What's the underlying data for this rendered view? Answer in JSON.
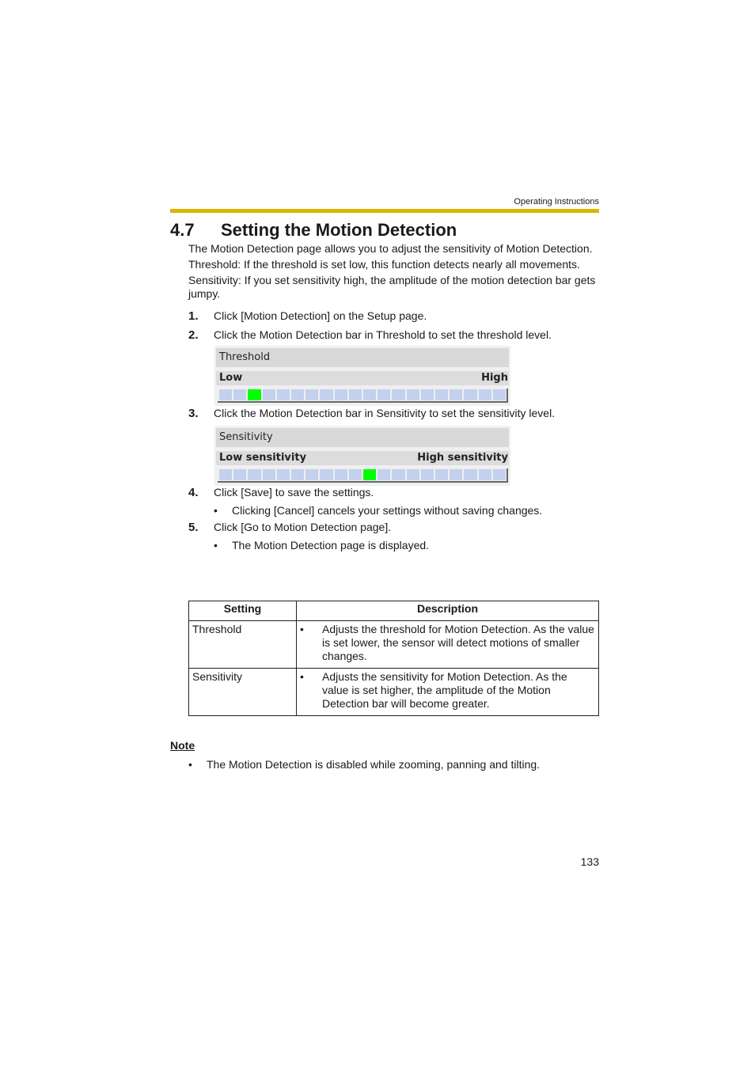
{
  "header": {
    "section_label": "Operating Instructions",
    "rule_color": "#d9b600"
  },
  "title": {
    "number": "4.7",
    "text": "Setting the Motion Detection"
  },
  "intro": [
    "The Motion Detection page allows you to adjust the sensitivity of Motion Detection.",
    "Threshold: If the threshold is set low, this function detects nearly all movements.",
    "Sensitivity: If you set sensitivity high, the amplitude of the motion detection bar gets jumpy."
  ],
  "steps": [
    {
      "num": "1.",
      "text": "Click [Motion Detection] on the Setup page."
    },
    {
      "num": "2.",
      "text": "Click the Motion Detection bar in Threshold to set the threshold level."
    },
    {
      "num": "3.",
      "text": "Click the Motion Detection bar in Sensitivity to set the sensitivity level."
    },
    {
      "num": "4.",
      "text": "Click [Save] to save the settings.",
      "bullet": "Clicking [Cancel] cancels your settings without saving changes."
    },
    {
      "num": "5.",
      "text": "Click [Go to Motion Detection page].",
      "bullet": "The Motion Detection page is displayed."
    }
  ],
  "threshold_panel": {
    "title": "Threshold",
    "low_label": "Low",
    "high_label": "High",
    "segments": 20,
    "selected_level": 3,
    "active_color": "#00ff00",
    "inactive_color": "#c4d0ee"
  },
  "sensitivity_panel": {
    "title": "Sensitivity",
    "low_label": "Low sensitivity",
    "high_label": "High sensitivity",
    "segments": 20,
    "selected_level": 11,
    "active_color": "#00ff00",
    "inactive_color": "#c4d0ee"
  },
  "table": {
    "headers": [
      "Setting",
      "Description"
    ],
    "rows": [
      {
        "setting": "Threshold",
        "description": "Adjusts the threshold for Motion Detection. As the value is set lower, the sensor will detect motions of smaller changes."
      },
      {
        "setting": "Sensitivity",
        "description": "Adjusts the sensitivity for Motion Detection. As the value is set higher, the amplitude of the Motion Detection bar will become greater."
      }
    ]
  },
  "note": {
    "title": "Note",
    "items": [
      "The Motion Detection is disabled while zooming, panning and tilting."
    ]
  },
  "bullet_glyph": "•",
  "page_number": "133"
}
